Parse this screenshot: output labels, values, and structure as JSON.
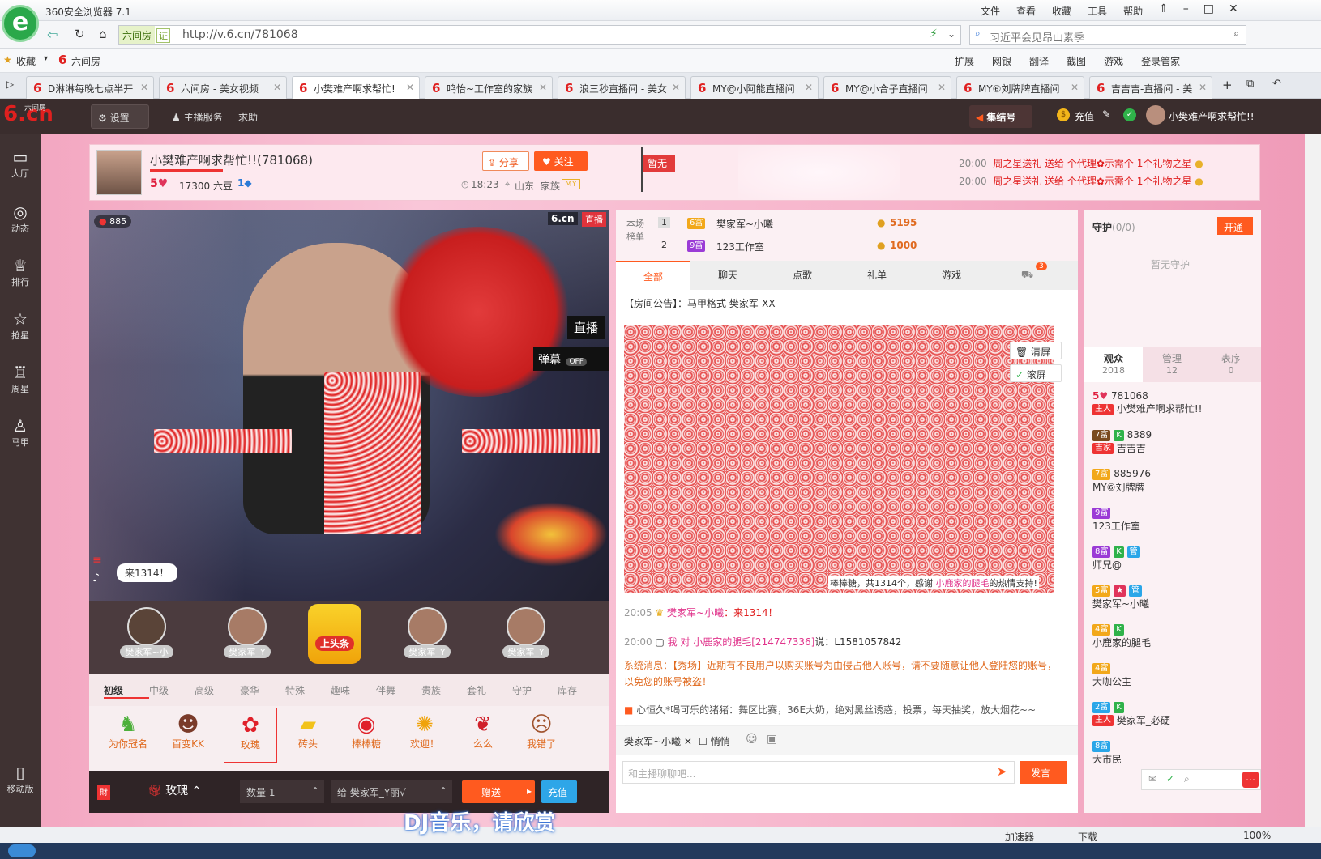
{
  "browser": {
    "app_title": "360安全浏览器 7.1",
    "menu": [
      "文件",
      "查看",
      "收藏",
      "工具",
      "帮助"
    ],
    "logo_glyph": "e",
    "site_badge": "六间房",
    "cert": "证",
    "url": "http://v.6.cn/781068",
    "search_text": "习近平会见昂山素季",
    "favorites_label": "收藏",
    "fav_item": "六间房",
    "toolbar_items": [
      "扩展",
      "网银",
      "翻译",
      "截图",
      "游戏",
      "登录管家"
    ],
    "tabs": [
      "D淋淋每晚七点半开",
      "六间房 - 美女视频",
      "小樊难产啊求帮忙!",
      "鸣怡~工作室的家族",
      "浪三秒直播间 - 美女",
      "MY@小阿能直播间",
      "MY@小合子直播间",
      "MY⑥刘牌牌直播间",
      "吉吉吉-直播间 - 美"
    ],
    "status_items": [
      "加速器",
      "下载",
      "100%"
    ]
  },
  "site": {
    "logo": "6.cn",
    "logo_sub": "六间房",
    "settings": "设置",
    "host_service": "主播服务",
    "help": "求助",
    "gather": "集结号",
    "recharge": "充值",
    "username": "小樊难产啊求帮忙!!"
  },
  "leftnav": [
    "大厅",
    "动态",
    "排行",
    "抢星",
    "周星",
    "马甲",
    "移动版"
  ],
  "room": {
    "title": "小樊难产啊求帮忙!!(781068)",
    "level": "5",
    "beans": "17300 六豆",
    "fans": "1",
    "share": "分享",
    "follow": "关注",
    "time": "18:23",
    "location": "山东",
    "family_label": "家族",
    "family": "MY",
    "flag": "暂无",
    "announce": [
      {
        "time": "20:00",
        "text": "周之星送礼 送给 个代理✿示需个 1个礼物之星"
      },
      {
        "time": "20:00",
        "text": "周之星送礼 送给 个代理✿示需个 1个礼物之星"
      }
    ]
  },
  "video": {
    "viewers": "885",
    "live_tag": "直播",
    "danmu": "弹幕",
    "danmu_state": "OFF",
    "bubble": "来1314！",
    "zhibo": "直播",
    "brand": "6.cn"
  },
  "gift_hosts": [
    "樊家军~小",
    "樊家军_Y",
    "上头条",
    "樊家军_Y",
    "樊家军_Y"
  ],
  "gift_tabs": [
    "初级",
    "中级",
    "高级",
    "豪华",
    "特殊",
    "趣味",
    "伴舞",
    "贵族",
    "套礼",
    "守护",
    "库存"
  ],
  "gifts": [
    "为你冠名",
    "百变KK",
    "玫瑰",
    "砖头",
    "棒棒糖",
    "欢迎！",
    "么么",
    "我错了"
  ],
  "sendbar": {
    "selected_gift": "玫瑰",
    "qty_label": "数量",
    "qty": "1",
    "to_label": "给",
    "to": "樊家军_Y丽√",
    "send": "赠送",
    "recharge": "充值"
  },
  "ranking": {
    "label": "本场榜单",
    "rows": [
      {
        "rank": "1",
        "name": "樊家军~小曦",
        "badge": "6富",
        "score": "5195"
      },
      {
        "rank": "2",
        "name": "123工作室",
        "badge": "9富",
        "score": "1000"
      }
    ]
  },
  "chat_tabs": [
    "全部",
    "聊天",
    "点歌",
    "礼单",
    "游戏"
  ],
  "chat_tab_count": "3",
  "chat": {
    "notice": "【房间公告】：马甲格式 樊家军-XX",
    "clear": "清屏",
    "scroll": "滚屏",
    "lolly_msg_prefix": "棒棒糖，共1314个，感谢",
    "lolly_msg_user": "小鹿家的腿毛",
    "lolly_msg_suffix": "的热情支持!",
    "msg1_time": "20:05",
    "msg1_user": "樊家军~小曦",
    "msg1_text": "：来1314！",
    "msg2_time": "20:00",
    "msg2_text_a": "我 对",
    "msg2_user": "小鹿家的腿毛[214747336]",
    "msg2_text_b": "说：L1581057842",
    "system": "系统消息：【秀场】近期有不良用户以购买账号为由侵占他人账号，请不要随意让他人登陆您的账号，以免您的账号被盗！",
    "marquee": "心恒久*喝可乐的猪猪：舞区比赛，36E大奶，绝对黑丝诱惑，投票，每天抽奖，放大烟花~~",
    "target": "樊家军~小曦",
    "private": "悄悄",
    "input_placeholder": "和主播聊聊吧...",
    "send": "发言"
  },
  "guard": {
    "title": "守护",
    "count": "(0/0)",
    "open": "开通",
    "empty": "暂无守护"
  },
  "audience_tabs": [
    {
      "label": "观众",
      "count": "2018"
    },
    {
      "label": "管理",
      "count": "12"
    },
    {
      "label": "表序",
      "count": "0"
    }
  ],
  "audience": [
    {
      "badge": "5",
      "id": "781068",
      "tag": "主人",
      "name": "小樊难产啊求帮忙!!"
    },
    {
      "badge": "7富",
      "id": "8389",
      "tag": "吉家",
      "name": "吉吉吉-"
    },
    {
      "badge": "7富",
      "id": "885976",
      "tag": "",
      "name": "MY⑥刘牌牌"
    },
    {
      "badge": "9富",
      "id": "",
      "tag": "",
      "name": "123工作室"
    },
    {
      "badge": "8富",
      "id": "",
      "tag": "",
      "name": "师兄@"
    },
    {
      "badge": "5富",
      "id": "",
      "tag": "",
      "name": "樊家军~小曦"
    },
    {
      "badge": "4富",
      "id": "",
      "tag": "",
      "name": "小鹿家的腿毛"
    },
    {
      "badge": "4富",
      "id": "",
      "tag": "",
      "name": "大咖公主"
    },
    {
      "badge": "2富",
      "id": "",
      "tag": "主人",
      "name": "樊家军_必硬"
    },
    {
      "badge": "8富",
      "id": "",
      "tag": "",
      "name": "大市民"
    }
  ],
  "overlay_text": "DJ音乐，请欣赏",
  "colors": {
    "accent": "#e0338b",
    "orange": "#ff5a1f",
    "sitebar": "#3a2d2d",
    "pink_bg": "#f6b3ca"
  }
}
